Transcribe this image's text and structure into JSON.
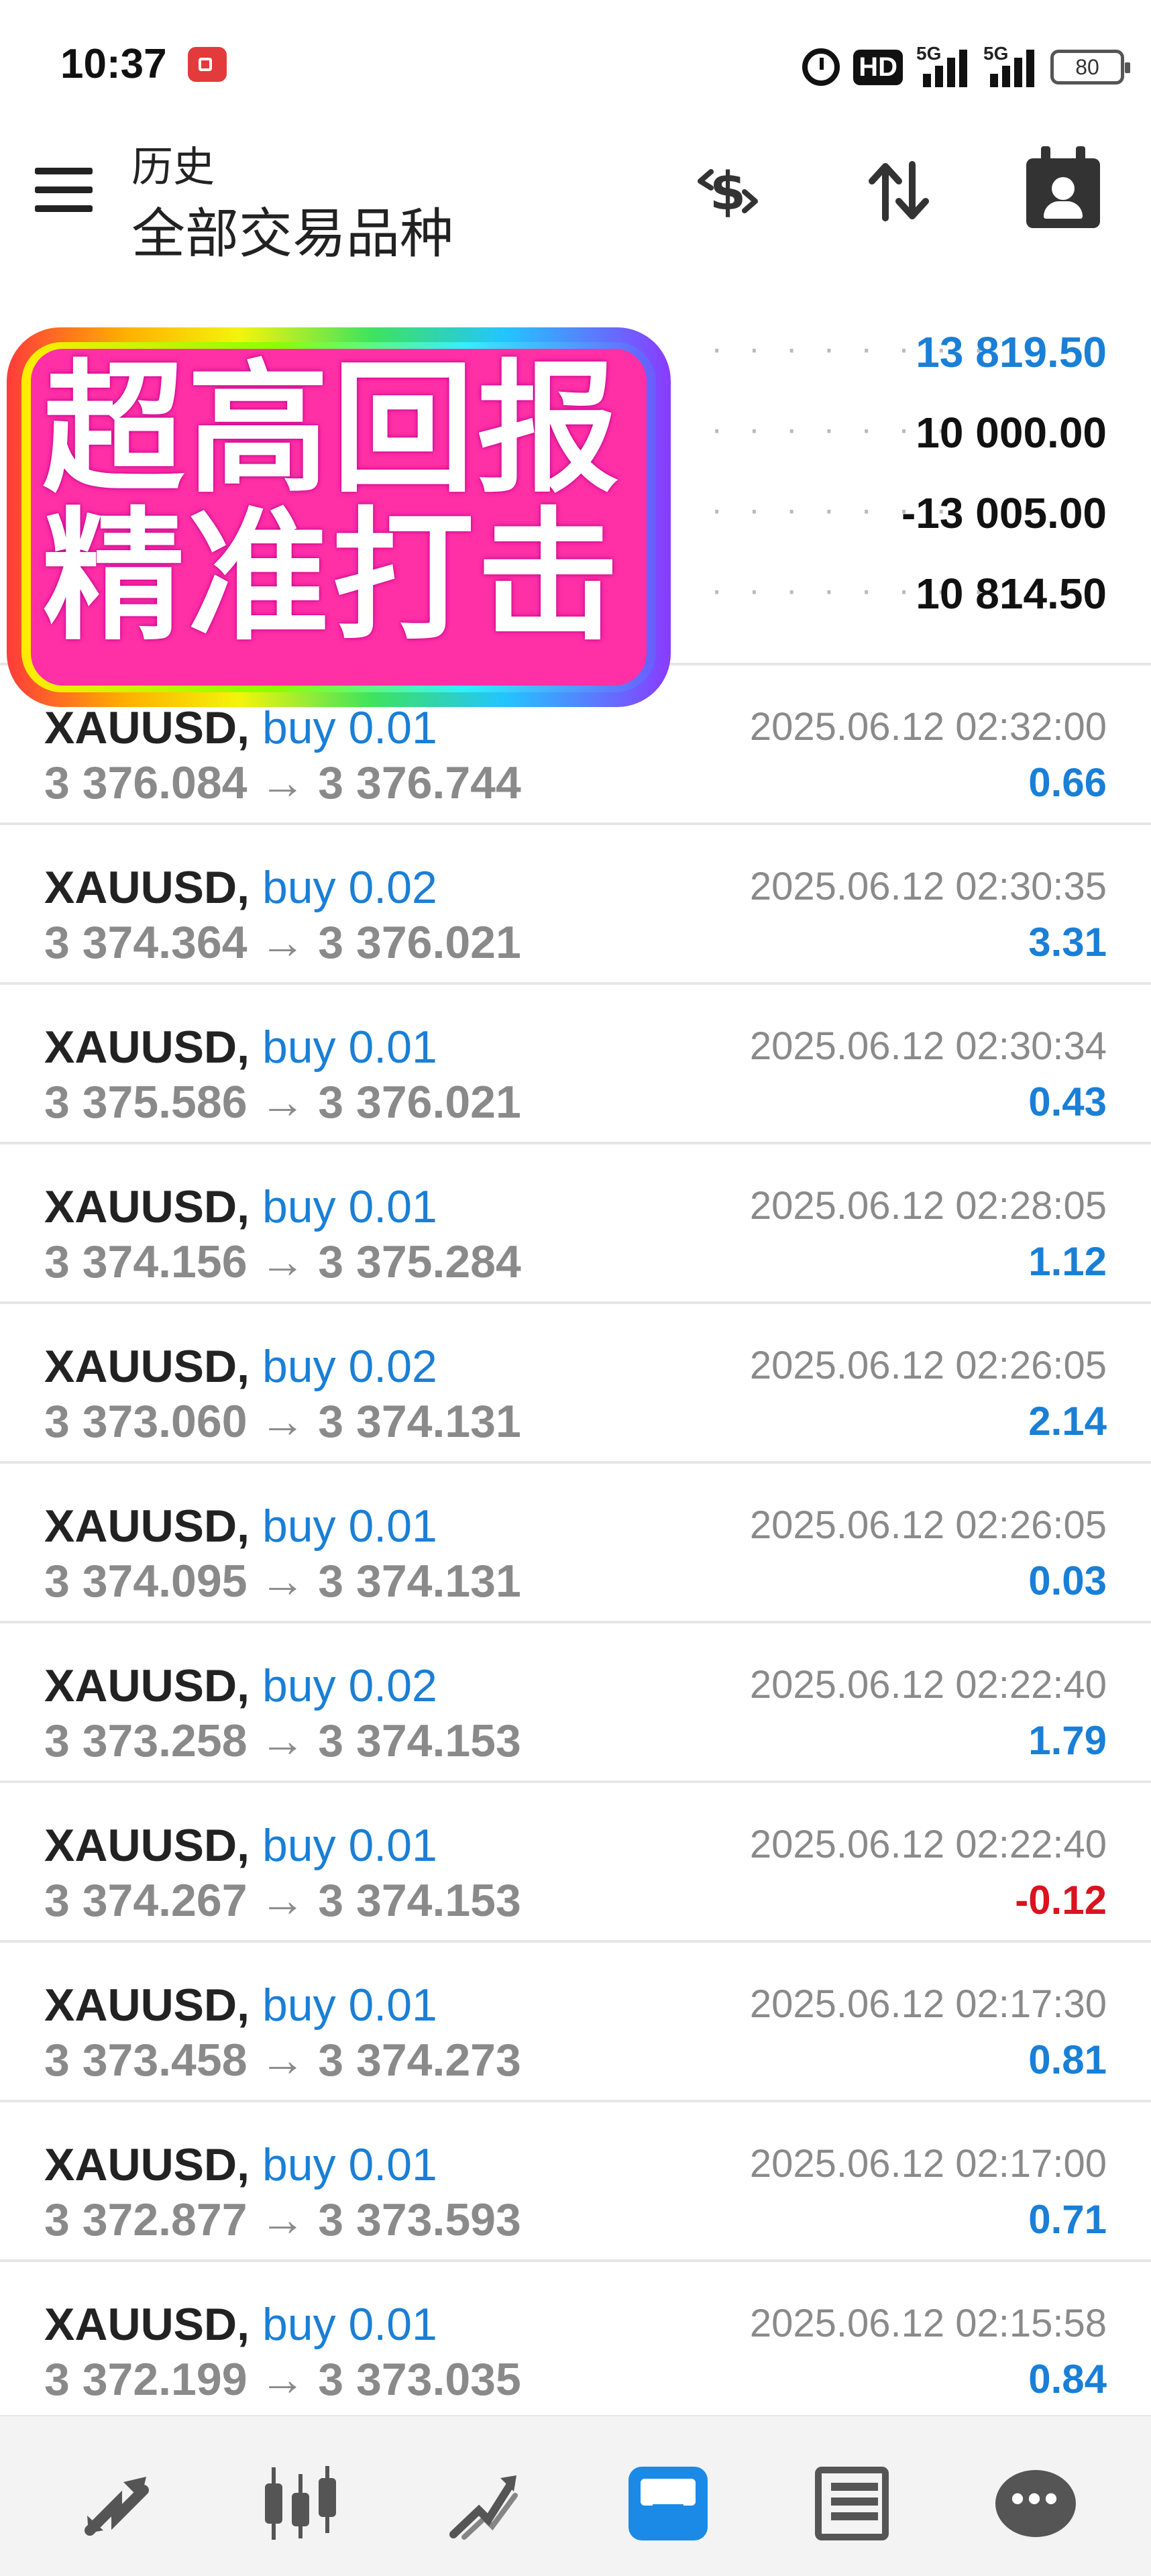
{
  "status_bar": {
    "time": "10:37",
    "hd_label": "HD",
    "sig1_label": "5G",
    "sig2_label": "5G",
    "battery": "80"
  },
  "app_bar": {
    "title": "历史",
    "subtitle": "全部交易品种"
  },
  "summary": {
    "rows": [
      {
        "label": "",
        "value": "13 819.50",
        "color": "#1a7fd6"
      },
      {
        "label": "",
        "value": "10 000.00"
      },
      {
        "label": "",
        "value": "-13 005.00"
      },
      {
        "label": "",
        "value": "10 814.50"
      }
    ],
    "dots": "· · · · · · · ·"
  },
  "overlay": {
    "line1": "超高回报",
    "line2": "精准打击"
  },
  "trades": [
    {
      "symbol": "XAUUSD,",
      "side": "buy 0.01",
      "prices": "3 376.084 → 3 376.744",
      "datetime": "2025.06.12 02:32:00",
      "profit": "0.66"
    },
    {
      "symbol": "XAUUSD,",
      "side": "buy 0.02",
      "prices": "3 374.364 → 3 376.021",
      "datetime": "2025.06.12 02:30:35",
      "profit": "3.31"
    },
    {
      "symbol": "XAUUSD,",
      "side": "buy 0.01",
      "prices": "3 375.586 → 3 376.021",
      "datetime": "2025.06.12 02:30:34",
      "profit": "0.43"
    },
    {
      "symbol": "XAUUSD,",
      "side": "buy 0.01",
      "prices": "3 374.156 → 3 375.284",
      "datetime": "2025.06.12 02:28:05",
      "profit": "1.12"
    },
    {
      "symbol": "XAUUSD,",
      "side": "buy 0.02",
      "prices": "3 373.060 → 3 374.131",
      "datetime": "2025.06.12 02:26:05",
      "profit": "2.14"
    },
    {
      "symbol": "XAUUSD,",
      "side": "buy 0.01",
      "prices": "3 374.095 → 3 374.131",
      "datetime": "2025.06.12 02:26:05",
      "profit": "0.03"
    },
    {
      "symbol": "XAUUSD,",
      "side": "buy 0.02",
      "prices": "3 373.258 → 3 374.153",
      "datetime": "2025.06.12 02:22:40",
      "profit": "1.79"
    },
    {
      "symbol": "XAUUSD,",
      "side": "buy 0.01",
      "prices": "3 374.267 → 3 374.153",
      "datetime": "2025.06.12 02:22:40",
      "profit": "-0.12",
      "negative": true
    },
    {
      "symbol": "XAUUSD,",
      "side": "buy 0.01",
      "prices": "3 373.458 → 3 374.273",
      "datetime": "2025.06.12 02:17:30",
      "profit": "0.81"
    },
    {
      "symbol": "XAUUSD,",
      "side": "buy 0.01",
      "prices": "3 372.877 → 3 373.593",
      "datetime": "2025.06.12 02:17:00",
      "profit": "0.71"
    },
    {
      "symbol": "XAUUSD,",
      "side": "buy 0.01",
      "prices": "3 372.199 → 3 373.035",
      "datetime": "2025.06.12 02:15:58",
      "profit": "0.84"
    }
  ],
  "colors": {
    "accent": "#1a7fd6",
    "negative": "#d8141f",
    "muted": "#8a8a8a"
  },
  "bottom_nav": [
    {
      "icon": "quotes-icon"
    },
    {
      "icon": "chart-icon"
    },
    {
      "icon": "trade-icon"
    },
    {
      "icon": "history-icon",
      "active": true
    },
    {
      "icon": "news-icon"
    },
    {
      "icon": "messages-icon"
    }
  ]
}
